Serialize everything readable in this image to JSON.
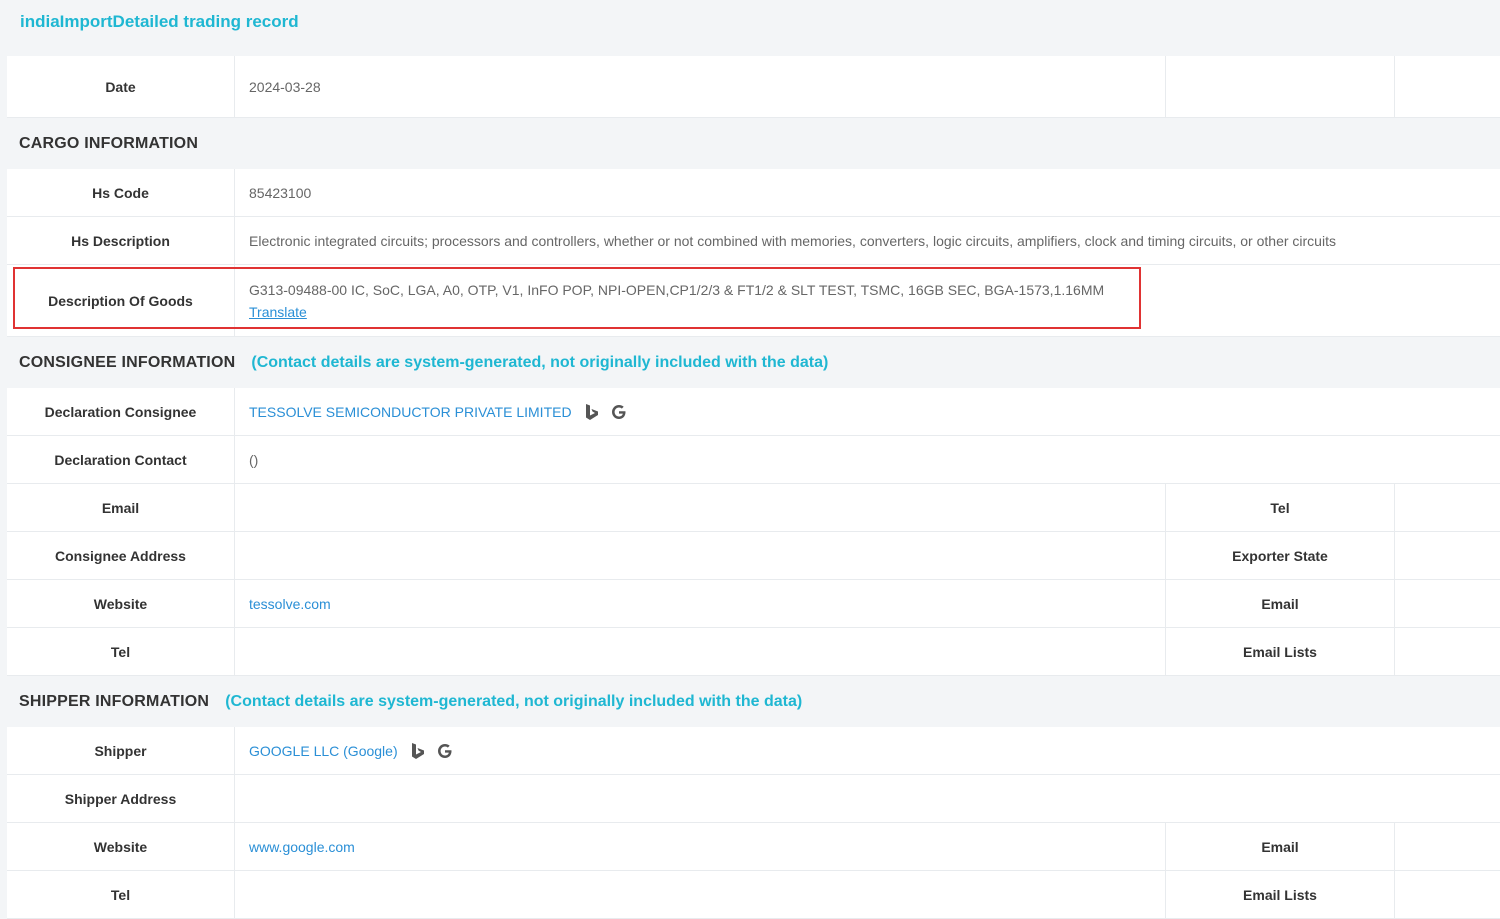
{
  "page": {
    "title": "indiaImportDetailed trading record"
  },
  "summary": {
    "date_label": "Date",
    "date_value": "2024-03-28"
  },
  "cargo": {
    "title": "CARGO INFORMATION",
    "hs_code_label": "Hs Code",
    "hs_code_value": "85423100",
    "hs_desc_label": "Hs Description",
    "hs_desc_value": "Electronic integrated circuits; processors and controllers, whether or not combined with memories, converters, logic circuits, amplifiers, clock and timing circuits, or other circuits",
    "goods_label": "Description Of Goods",
    "goods_value": "G313-09488-00 IC, SoC, LGA, A0, OTP, V1, InFO POP, NPI-OPEN,CP1/2/3 & FT1/2 & SLT TEST, TSMC, 16GB SEC, BGA-1573,1.16MM",
    "translate_label": "Translate"
  },
  "consignee": {
    "title": "CONSIGNEE INFORMATION",
    "note": "(Contact details are system-generated, not originally included with the data)",
    "declaration_consignee_label": "Declaration Consignee",
    "declaration_consignee_value": "TESSOLVE SEMICONDUCTOR PRIVATE LIMITED",
    "declaration_contact_label": "Declaration Contact",
    "declaration_contact_value": "()",
    "email_label": "Email",
    "tel_label": "Tel",
    "address_label": "Consignee Address",
    "exporter_state_label": "Exporter State",
    "website_label": "Website",
    "website_value": "tessolve.com",
    "email2_label": "Email",
    "tel2_label": "Tel",
    "email_lists_label": "Email Lists"
  },
  "shipper": {
    "title": "SHIPPER INFORMATION",
    "note": "(Contact details are system-generated, not originally included with the data)",
    "shipper_label": "Shipper",
    "shipper_value": "GOOGLE LLC (Google)",
    "address_label": "Shipper Address",
    "website_label": "Website",
    "website_value": "www.google.com",
    "email_label": "Email",
    "tel_label": "Tel",
    "email_lists_label": "Email Lists"
  },
  "icons": {
    "bing": "bing-icon",
    "google": "google-icon",
    "accent": "#1fb7d2",
    "link": "#2a8fd6",
    "highlight": "#e03333"
  }
}
